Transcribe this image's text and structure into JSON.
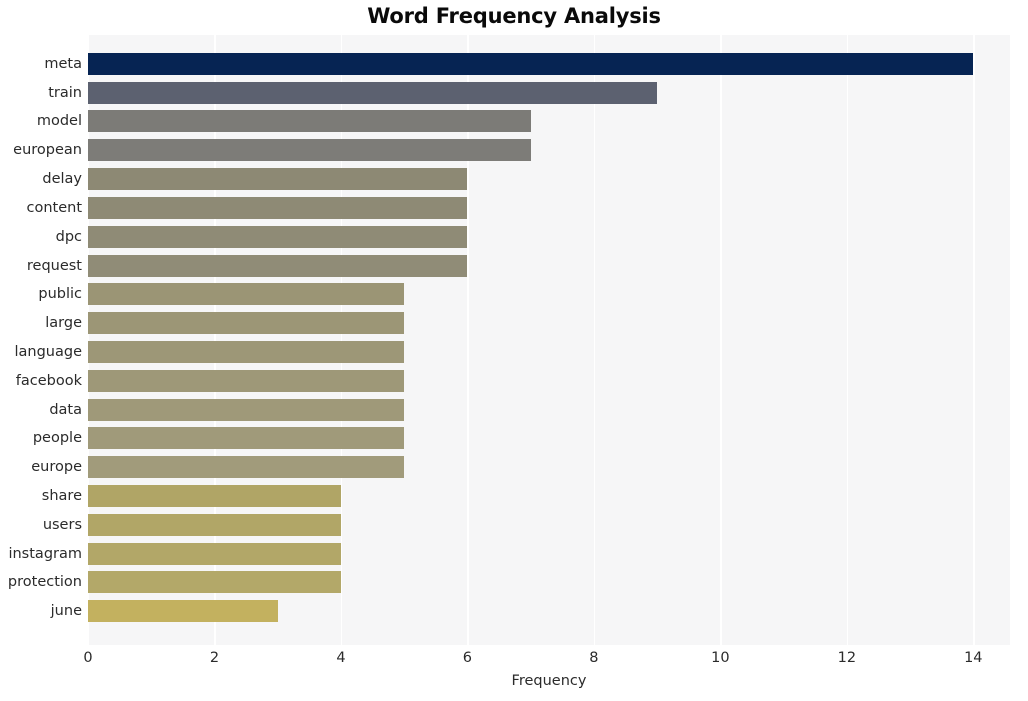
{
  "chart_data": {
    "type": "bar",
    "orientation": "horizontal",
    "title": "Word Frequency Analysis",
    "xlabel": "Frequency",
    "ylabel": "",
    "categories": [
      "meta",
      "train",
      "model",
      "european",
      "delay",
      "content",
      "dpc",
      "request",
      "public",
      "large",
      "language",
      "facebook",
      "data",
      "people",
      "europe",
      "share",
      "users",
      "instagram",
      "protection",
      "june"
    ],
    "values": [
      14,
      9,
      7,
      7,
      6,
      6,
      6,
      6,
      5,
      5,
      5,
      5,
      5,
      5,
      5,
      4,
      4,
      4,
      4,
      3
    ],
    "bar_colors": [
      "#062453",
      "#5c6170",
      "#7c7b77",
      "#7d7c78",
      "#8d8974",
      "#8e8a75",
      "#8f8b76",
      "#908c77",
      "#9b9575",
      "#9c9676",
      "#9d9777",
      "#9e9878",
      "#9f9979",
      "#a09a7a",
      "#a19b7b",
      "#b0a566",
      "#b1a667",
      "#b2a768",
      "#b3a869",
      "#c3b15f"
    ],
    "xlim": [
      0,
      14.58
    ],
    "xticks": [
      0,
      2,
      4,
      6,
      8,
      10,
      12,
      14
    ],
    "xticklabels": [
      "0",
      "2",
      "4",
      "6",
      "8",
      "10",
      "12",
      "14"
    ],
    "grid": true,
    "grid_axis": "x",
    "grid_color": "#ffffff",
    "plot_background": "#f6f6f7",
    "figure_background": "#ffffff",
    "legend": null,
    "annotations": []
  }
}
